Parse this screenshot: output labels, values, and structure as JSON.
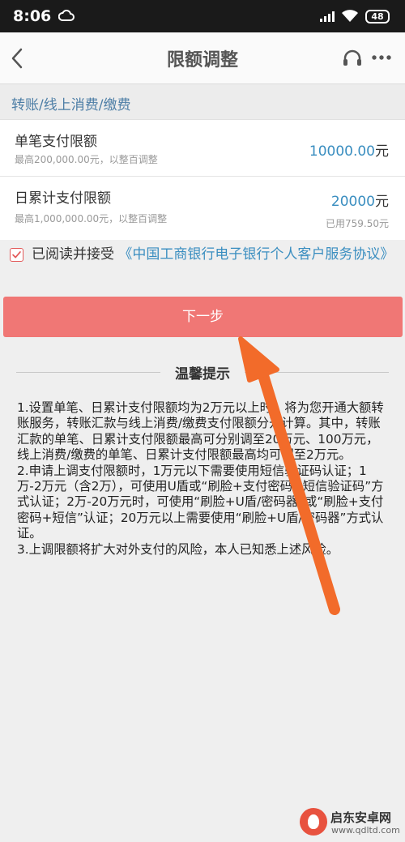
{
  "status": {
    "time": "8:06",
    "battery": "48"
  },
  "nav": {
    "title": "限额调整"
  },
  "section": {
    "title": "转账/线上消费/缴费"
  },
  "limits": [
    {
      "label": "单笔支付限额",
      "hint": "最高200,000.00元，以整百调整",
      "value": "10000.00",
      "unit": "元"
    },
    {
      "label": "日累计支付限额",
      "hint": "最高1,000,000.00元，以整百调整",
      "value": "20000",
      "unit": "元",
      "used": "已用759.50元"
    }
  ],
  "agreement": {
    "checked": true,
    "prefix": "已阅读并接受",
    "link": "《中国工商银行电子银行个人客户服务协议》"
  },
  "next_label": "下一步",
  "tips": {
    "title": "温馨提示",
    "p1": "1.设置单笔、日累计支付限额均为2万元以上时，将为您开通大额转账服务，转账汇款与线上消费/缴费支付限额分开计算。其中，转账汇款的单笔、日累计支付限额最高可分别调至20万元、100万元，线上消费/缴费的单笔、日累计支付限额最高均可调至2万元。",
    "p2": "2.申请上调支付限额时，1万元以下需要使用短信验证码认证；1万-2万元（含2万），可使用U盾或“刷脸+支付密码+短信验证码”方式认证；2万-20万元时，可使用“刷脸+U盾/密码器”或“刷脸+支付密码+短信”认证；20万元以上需要使用“刷脸+U盾/密码器”方式认证。",
    "p3": "3.上调限额将扩大对外支付的风险，本人已知悉上述风险。"
  },
  "watermark": {
    "name": "启东安卓网",
    "url": "www.qdltd.com"
  },
  "colors": {
    "accent": "#3a8ec0",
    "button": "#f07775",
    "arrow": "#f26b2a",
    "checkbox": "#e35a5a"
  },
  "icons": [
    "back-icon",
    "headset-icon",
    "more-icon",
    "checkbox-checked-icon",
    "cloud-icon",
    "signal-icon",
    "wifi-icon",
    "battery-icon",
    "arrow-annotation"
  ]
}
